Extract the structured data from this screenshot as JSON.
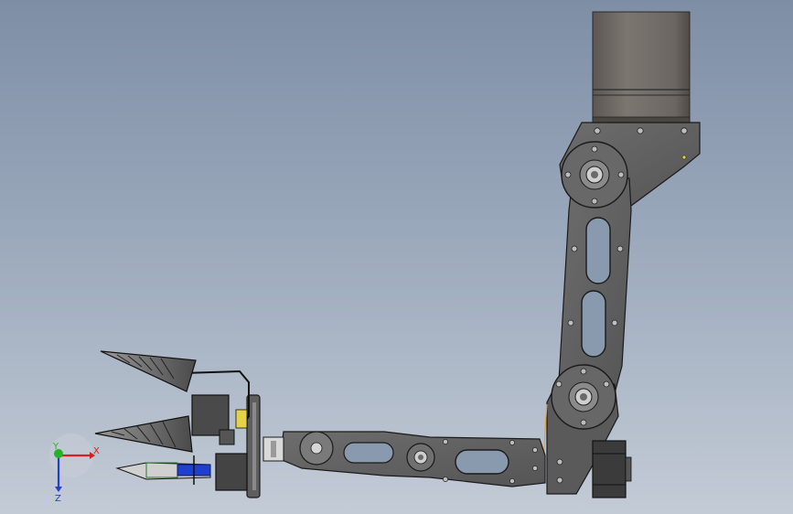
{
  "triad": {
    "x_label": "X",
    "y_label": "Y",
    "z_label": "Z",
    "x_color": "#d42020",
    "y_color": "#22b422",
    "z_color": "#2040c8"
  },
  "colors": {
    "background_top": "#7e8ea5",
    "background_bottom": "#c3cbd6",
    "link_plate": "#5f5f5f",
    "motor_cylinder": "#6f6a66",
    "bracket": "#6b6b6b",
    "outline": "#1a1a1a",
    "bolt": "#bdbdbd",
    "accent_blue": "#1f3fd0",
    "accent_yellow": "#e2d34a"
  },
  "scene": {
    "parts": [
      "motor-cylinder",
      "shoulder-bracket",
      "upper-arm-link",
      "elbow-joint",
      "forearm-link",
      "stepper-motor",
      "wrist-flange",
      "gripper-upper-finger",
      "gripper-lower-finger",
      "gripper-lead-screw"
    ]
  }
}
